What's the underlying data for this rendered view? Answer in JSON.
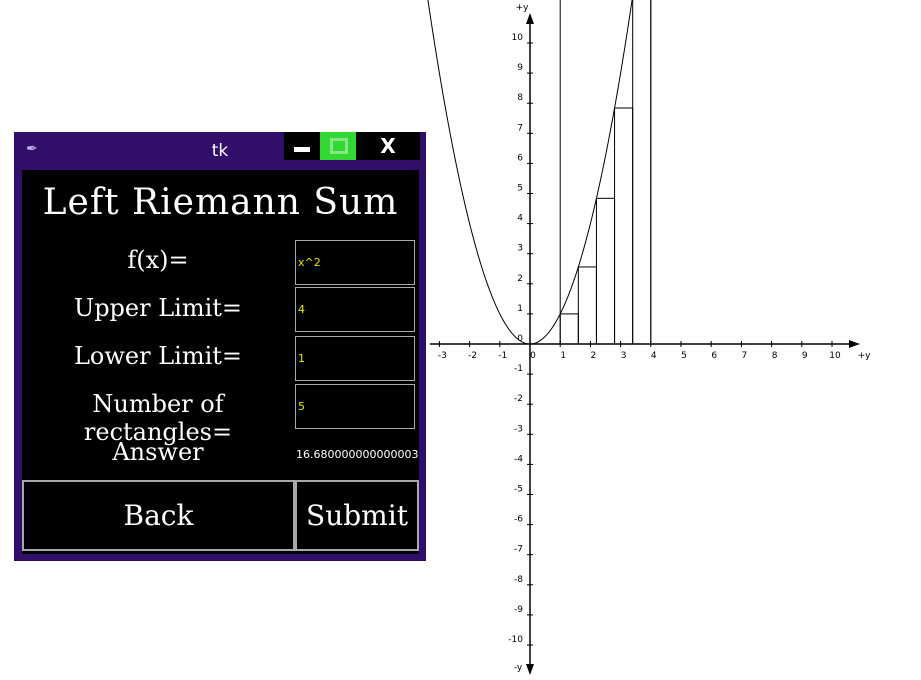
{
  "window": {
    "title": "tk",
    "close_label": "X",
    "heading": "Left Riemann Sum",
    "fields": [
      {
        "label": "f(x)=",
        "value": "x^2"
      },
      {
        "label": "Upper Limit=",
        "value": "4"
      },
      {
        "label": "Lower Limit=",
        "value": "1"
      },
      {
        "label": "Number of rectangles=",
        "value": "5"
      }
    ],
    "answer_label": "Answer",
    "answer_value": "16.680000000000003",
    "back_label": "Back",
    "submit_label": "Submit"
  },
  "chart_data": {
    "type": "line",
    "function": "x^2",
    "xlim": [
      -3,
      10
    ],
    "ylim": [
      -10,
      10
    ],
    "x_axis_label": "+y",
    "y_axis_label_top": "+y",
    "y_axis_label_bottom": "-y",
    "x_ticks": [
      "-3",
      "-2",
      "-1",
      "0",
      "1",
      "2",
      "3",
      "4",
      "5",
      "6",
      "7",
      "8",
      "9",
      "10"
    ],
    "y_ticks": [
      "10",
      "9",
      "8",
      "7",
      "6",
      "5",
      "4",
      "3",
      "2",
      "1",
      "0",
      "-1",
      "-2",
      "-3",
      "-4",
      "-5",
      "-6",
      "-7",
      "-8",
      "-9",
      "-10"
    ],
    "rectangles": [
      {
        "x0": 1.0,
        "x1": 1.6,
        "height": 1.0
      },
      {
        "x0": 1.6,
        "x1": 2.2,
        "height": 2.56
      },
      {
        "x0": 2.2,
        "x1": 2.8,
        "height": 4.84
      },
      {
        "x0": 2.8,
        "x1": 3.4,
        "height": 7.84
      },
      {
        "x0": 3.4,
        "x1": 4.0,
        "height": 11.56
      }
    ],
    "boundary_lines": [
      1,
      4
    ]
  }
}
